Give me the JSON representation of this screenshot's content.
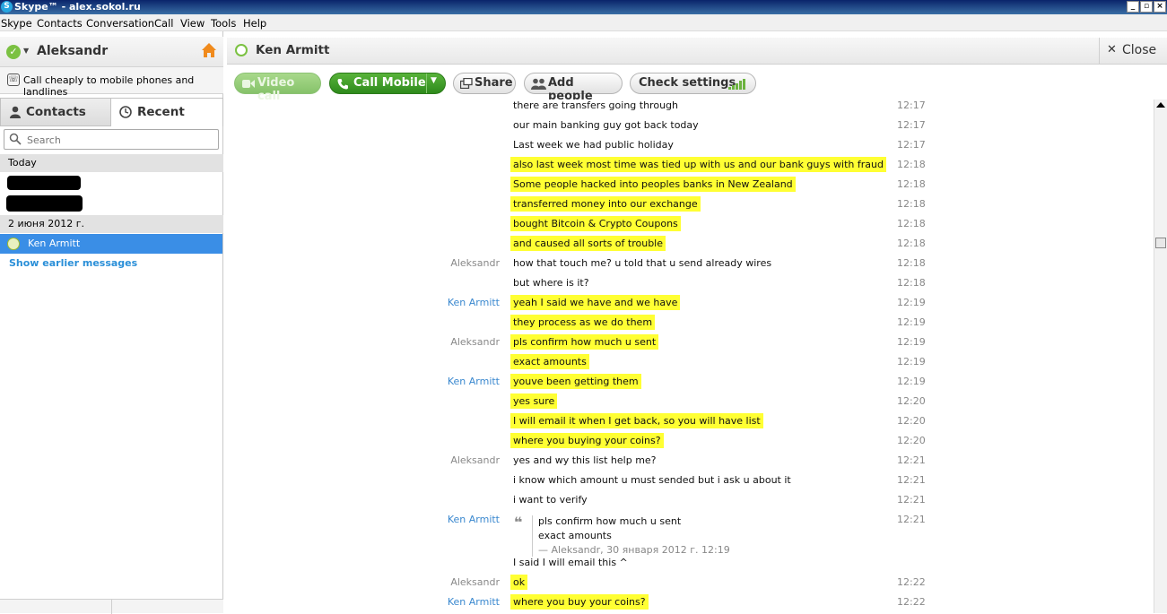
{
  "window": {
    "title": "Skype™ - alex.sokol.ru",
    "min": "_",
    "max": "▫",
    "close": "×"
  },
  "menu": [
    "Skype",
    "Contacts",
    "Conversation",
    "Call",
    "View",
    "Tools",
    "Help"
  ],
  "sidebar": {
    "profile_name": "Aleksandr",
    "promo": "Call cheaply to mobile phones and landlines",
    "tabs": {
      "contacts": "Contacts",
      "recent": "Recent"
    },
    "search_placeholder": "Search",
    "groups": {
      "today": "Today",
      "older": "2 июня 2012 г."
    },
    "selected_contact": "Ken Armitt",
    "show_earlier": "Show earlier messages"
  },
  "conversation": {
    "title": "Ken Armitt",
    "close_label": "Close",
    "toolbar": {
      "video_call": "Video call",
      "call_mobile": "Call Mobile",
      "share": "Share",
      "add_people": "Add people",
      "check_settings": "Check settings"
    },
    "messages": [
      {
        "sender": "",
        "text": "there are transfers going through",
        "time": "12:17",
        "highlight": false
      },
      {
        "sender": "",
        "text": "our main banking guy got back today",
        "time": "12:17",
        "highlight": false
      },
      {
        "sender": "",
        "text": "Last week we had public holiday",
        "time": "12:17",
        "highlight": false
      },
      {
        "sender": "",
        "text": "also last week most time was tied up with us and our bank guys with fraud",
        "time": "12:18",
        "highlight": true
      },
      {
        "sender": "",
        "text": "Some people hacked into peoples banks in New Zealand",
        "time": "12:18",
        "highlight": true
      },
      {
        "sender": "",
        "text": "transferred money into our exchange",
        "time": "12:18",
        "highlight": true
      },
      {
        "sender": "",
        "text": "bought Bitcoin & Crypto Coupons",
        "time": "12:18",
        "highlight": true
      },
      {
        "sender": "",
        "text": "and caused all sorts of trouble",
        "time": "12:18",
        "highlight": true
      },
      {
        "sender": "Aleksandr",
        "text": "how that touch me? u told that u send already wires",
        "time": "12:18",
        "highlight": false
      },
      {
        "sender": "",
        "text": "but where is it?",
        "time": "12:18",
        "highlight": false
      },
      {
        "sender": "Ken Armitt",
        "text": "yeah I said we have and we have",
        "time": "12:19",
        "highlight": true
      },
      {
        "sender": "",
        "text": "they process as we do them",
        "time": "12:19",
        "highlight": true
      },
      {
        "sender": "Aleksandr",
        "text": "pls confirm how much u sent",
        "time": "12:19",
        "highlight": true
      },
      {
        "sender": "",
        "text": "exact amounts",
        "time": "12:19",
        "highlight": true
      },
      {
        "sender": "Ken Armitt",
        "text": "youve been getting them",
        "time": "12:19",
        "highlight": true
      },
      {
        "sender": "",
        "text": "yes sure",
        "time": "12:20",
        "highlight": true
      },
      {
        "sender": "",
        "text": "I will email it when I get back, so you will have list",
        "time": "12:20",
        "highlight": true
      },
      {
        "sender": "",
        "text": "where you buying your coins?",
        "time": "12:20",
        "highlight": true
      },
      {
        "sender": "Aleksandr",
        "text": "yes and wy this list help me?",
        "time": "12:21",
        "highlight": false
      },
      {
        "sender": "",
        "text": "i know which amount u must sended but i ask u about it",
        "time": "12:21",
        "highlight": false
      },
      {
        "sender": "",
        "text": "i want to verify",
        "time": "12:21",
        "highlight": false
      }
    ],
    "quote": {
      "sender": "Ken Armitt",
      "time": "12:21",
      "mark": "❝",
      "lines": [
        "pls confirm how much u sent",
        "exact amounts"
      ],
      "meta": "— Aleksandr, 30 января 2012 г. 12:19"
    },
    "after_quote": [
      {
        "sender": "",
        "text": "I said I will email this ^",
        "time": "",
        "highlight": false
      },
      {
        "sender": "Aleksandr",
        "text": "ok",
        "time": "12:22",
        "highlight": true
      },
      {
        "sender": "Ken Armitt",
        "text": "where you buy your coins?",
        "time": "12:22",
        "highlight": true
      }
    ]
  }
}
